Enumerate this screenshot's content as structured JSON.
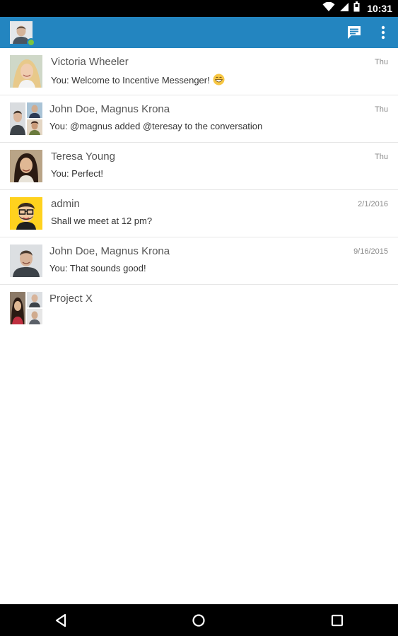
{
  "status_bar": {
    "time": "10:31",
    "icons": [
      "wifi-icon",
      "cell-signal-icon",
      "battery-icon"
    ]
  },
  "app_bar": {
    "self_avatar_icon": "user-avatar",
    "presence_color": "#7cc53f",
    "actions": [
      "compose-message-icon",
      "more-vert-icon"
    ],
    "background": "#2385c0"
  },
  "conversations": [
    {
      "name": "Victoria Wheeler",
      "preview": "You: Welcome to Incentive Messenger!",
      "emoji": "grinning-face",
      "date": "Thu"
    },
    {
      "name": "John Doe, Magnus Krona",
      "preview": "You: @magnus added @teresay to the conversation",
      "date": "Thu"
    },
    {
      "name": "Teresa Young",
      "preview": "You: Perfect!",
      "date": "Thu"
    },
    {
      "name": "admin",
      "preview": "Shall we meet at 12 pm?",
      "date": "2/1/2016"
    },
    {
      "name": "John Doe, Magnus Krona",
      "preview": "You: That sounds good!",
      "date": "9/16/2015"
    },
    {
      "name": "Project X",
      "preview": "",
      "date": ""
    }
  ],
  "nav_bar": {
    "buttons": [
      "back-icon",
      "home-icon",
      "recents-icon"
    ]
  }
}
